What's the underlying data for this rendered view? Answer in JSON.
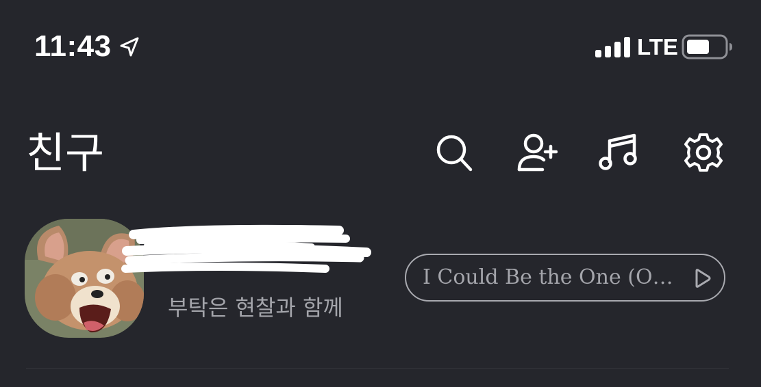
{
  "status_bar": {
    "time": "11:43",
    "network": "LTE",
    "location_icon": "location-arrow-icon",
    "signal_icon": "cellular-signal-icon",
    "battery_icon": "battery-icon"
  },
  "header": {
    "title": "친구",
    "icons": [
      "search-icon",
      "add-friend-icon",
      "music-icon",
      "settings-gear-icon"
    ]
  },
  "profile": {
    "status_message": "부탁은 현찰과 함께",
    "music_label": "I Could Be the One (O…",
    "music_play_icon": "play-icon"
  },
  "colors": {
    "background": "#25262c",
    "text_primary": "#ffffff",
    "text_secondary": "#a4a5ab",
    "pill_border": "#a9aab0"
  }
}
